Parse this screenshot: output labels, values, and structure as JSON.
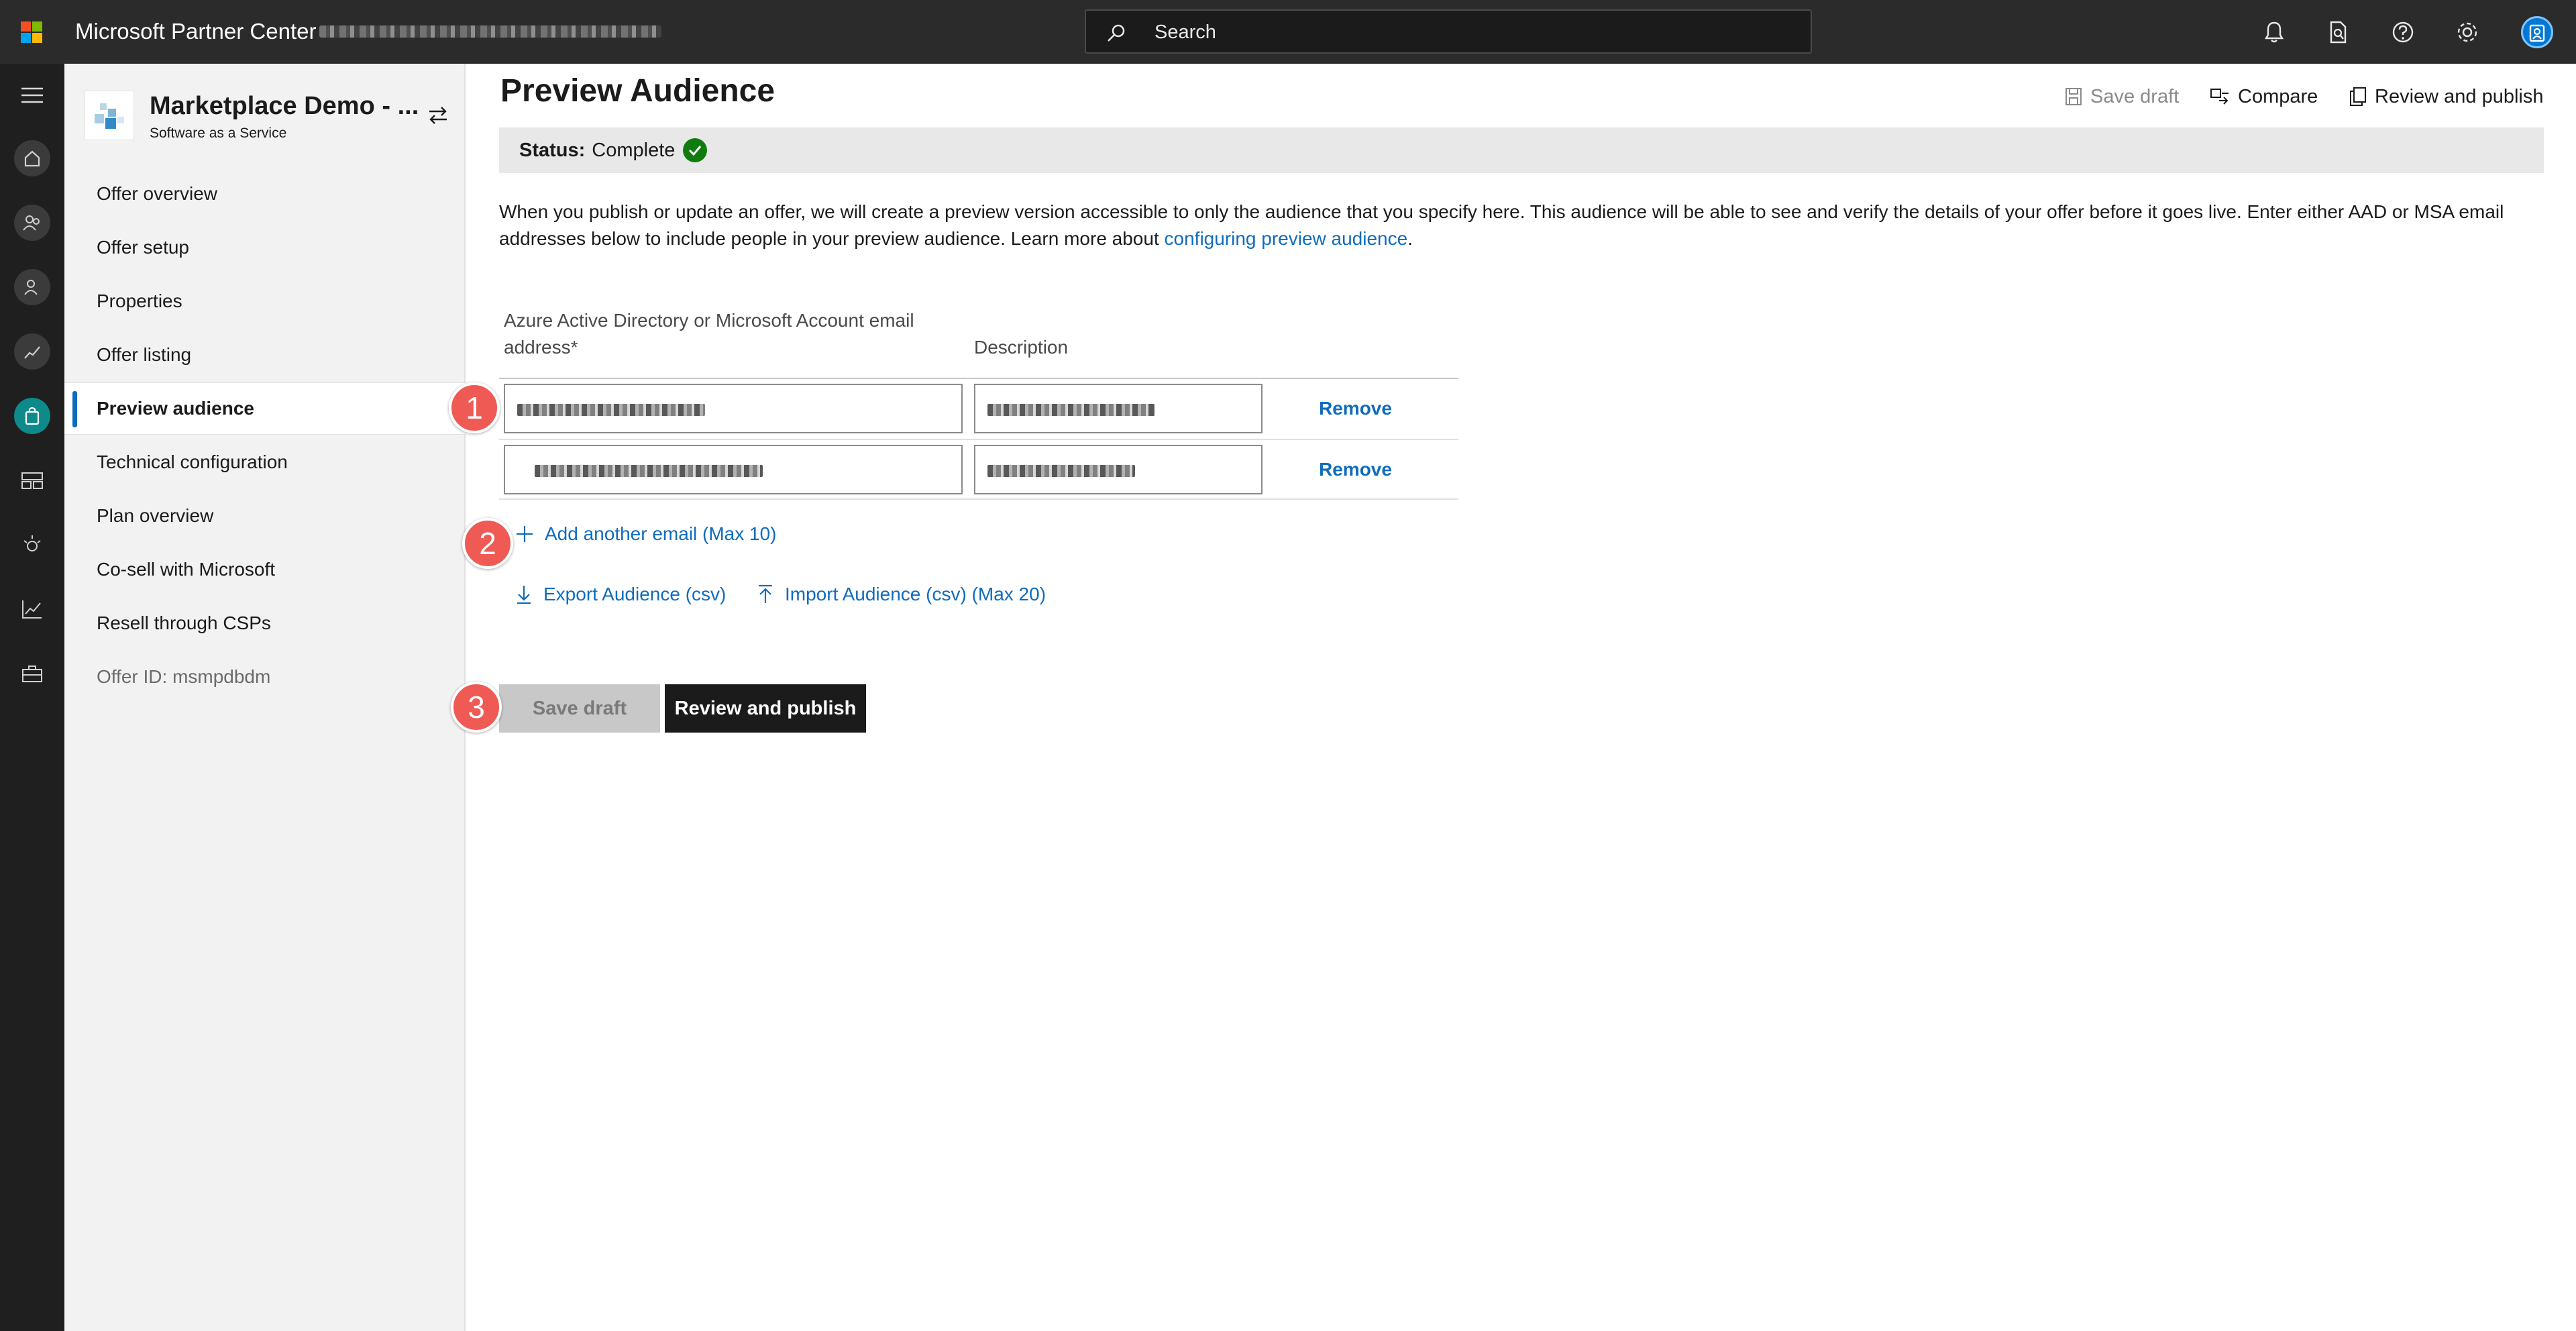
{
  "app": {
    "title": "Microsoft Partner Center"
  },
  "search": {
    "placeholder": "Search"
  },
  "topbar_icons": [
    "bell-icon",
    "document-search-icon",
    "help-icon",
    "settings-icon",
    "account-avatar"
  ],
  "rail_icons": [
    "hamburger-menu-icon",
    "home-icon",
    "people-icon",
    "user-icon",
    "growth-chart-icon",
    "marketplace-offers-icon",
    "workspaces-icon",
    "insights-icon",
    "analytics-icon",
    "toolbox-icon"
  ],
  "offer": {
    "name": "Marketplace Demo - ...",
    "type": "Software as a Service"
  },
  "sidebar": {
    "items": [
      {
        "label": "Offer overview"
      },
      {
        "label": "Offer setup"
      },
      {
        "label": "Properties"
      },
      {
        "label": "Offer listing"
      },
      {
        "label": "Preview audience",
        "active": true
      },
      {
        "label": "Technical configuration"
      },
      {
        "label": "Plan overview"
      },
      {
        "label": "Co-sell with Microsoft"
      },
      {
        "label": "Resell through CSPs"
      }
    ],
    "offer_id": "Offer ID: msmpdbdm"
  },
  "page": {
    "title": "Preview Audience"
  },
  "commands": {
    "save_draft": "Save draft",
    "compare": "Compare",
    "review_publish": "Review and publish"
  },
  "status": {
    "label": "Status:",
    "value": "Complete"
  },
  "description": {
    "text": "When you publish or update an offer, we will create a preview version accessible to only the audience that you specify here. This audience will be able to see and verify the details of your offer before it goes live. Enter either AAD or MSA email addresses below to include people in your preview audience. Learn more about ",
    "link": "configuring preview audience",
    "end": "."
  },
  "table": {
    "email_header_line1": "Azure Active Directory or Microsoft Account email",
    "email_header_line2": "address",
    "required_mark": "*",
    "description_header": "Description",
    "remove_label": "Remove",
    "rows": [
      {
        "email": "",
        "description": ""
      },
      {
        "email": "",
        "description": ""
      }
    ]
  },
  "actions": {
    "add_email": "Add another email (Max 10)",
    "export": "Export Audience (csv)",
    "import": "Import Audience (csv) (Max 20)"
  },
  "steps": [
    "1",
    "2",
    "3"
  ],
  "buttons": {
    "save_draft": "Save draft",
    "review_publish": "Review and publish"
  },
  "colors": {
    "accent": "#0f6cbd",
    "status_ok": "#107c10",
    "step_badge": "#ef5a54",
    "rail_active": "#0f8a8a"
  }
}
